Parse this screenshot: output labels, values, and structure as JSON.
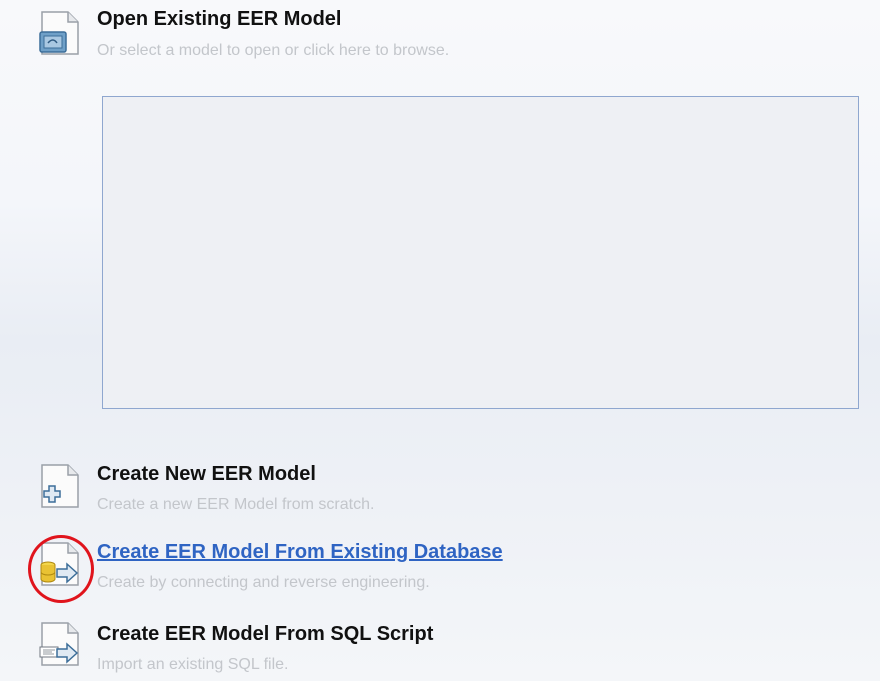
{
  "open_model": {
    "title": "Open Existing EER Model",
    "subtitle": "Or select a model to open or click here to browse.",
    "icon": "folder-document-icon"
  },
  "model_list": {
    "items": []
  },
  "actions": [
    {
      "title": "Create New EER Model",
      "subtitle": "Create a new EER Model from scratch.",
      "icon": "new-document-plus-icon"
    },
    {
      "title": "Create EER Model From Existing Database",
      "subtitle": "Create by connecting and reverse engineering.",
      "icon": "database-arrow-icon",
      "highlighted": true
    },
    {
      "title": "Create EER Model From SQL Script",
      "subtitle": "Import an existing SQL file.",
      "icon": "sql-arrow-icon"
    }
  ],
  "colors": {
    "link": "#2f64c3",
    "highlight_ring": "#e0141c",
    "subtitle": "#c3c6cb",
    "list_border": "#8fa7cf"
  }
}
